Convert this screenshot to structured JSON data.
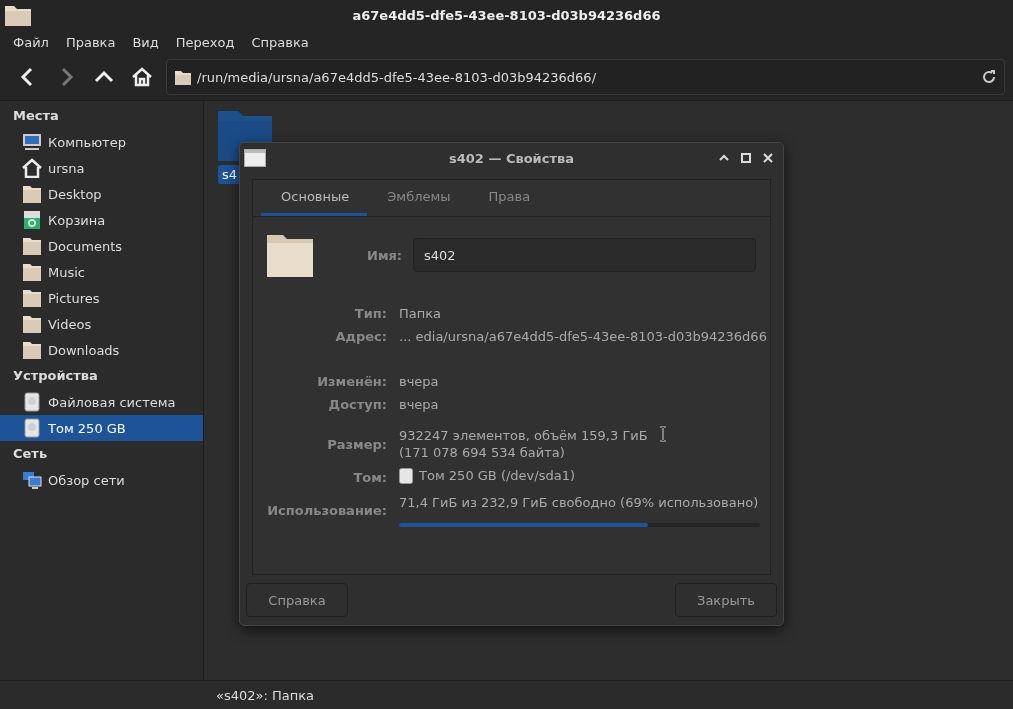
{
  "window": {
    "title": "a67e4dd5-dfe5-43ee-8103-d03b94236d66"
  },
  "menu": [
    "Файл",
    "Правка",
    "Вид",
    "Переход",
    "Справка"
  ],
  "toolbar": [
    {
      "kind": "back",
      "disabled": false
    },
    {
      "kind": "forward",
      "disabled": true
    },
    {
      "kind": "up",
      "disabled": false
    },
    {
      "kind": "home",
      "disabled": false
    }
  ],
  "location": "/run/media/ursna/a67e4dd5-dfe5-43ee-8103-d03b94236d66/",
  "sidebar": [
    {
      "heading": "Места",
      "items": [
        {
          "label": "Компьютер",
          "kind": "computer",
          "selected": false
        },
        {
          "label": "ursna",
          "kind": "home",
          "selected": false
        },
        {
          "label": "Desktop",
          "kind": "folder",
          "selected": false
        },
        {
          "label": "Корзина",
          "kind": "trash",
          "selected": false
        },
        {
          "label": "Documents",
          "kind": "folder",
          "selected": false
        },
        {
          "label": "Music",
          "kind": "folder",
          "selected": false
        },
        {
          "label": "Pictures",
          "kind": "folder",
          "selected": false
        },
        {
          "label": "Videos",
          "kind": "folder",
          "selected": false
        },
        {
          "label": "Downloads",
          "kind": "folder",
          "selected": false
        }
      ]
    },
    {
      "heading": "Устройства",
      "items": [
        {
          "label": "Файловая система",
          "kind": "drive",
          "selected": false
        },
        {
          "label": "Том 250 GB",
          "kind": "drive",
          "selected": true
        }
      ]
    },
    {
      "heading": "Сеть",
      "items": [
        {
          "label": "Обзор сети",
          "kind": "network",
          "selected": false
        }
      ]
    }
  ],
  "files": [
    {
      "name": "s4",
      "selected": true
    }
  ],
  "status_bar": "«s402»: Папка",
  "dialog": {
    "title": "s402 — Свойства",
    "tabs": [
      {
        "label": "Основные",
        "selected": true
      },
      {
        "label": "Эмблемы",
        "selected": false
      },
      {
        "label": "Права",
        "selected": false
      }
    ],
    "name_label": "Имя:",
    "name_value": "s402",
    "groups": [
      [
        {
          "kind": "text",
          "label": "Тип:",
          "value": "Папка"
        },
        {
          "kind": "text",
          "label": "Адрес:",
          "value": "... edia/ursna/a67e4dd5-dfe5-43ee-8103-d03b94236d66"
        }
      ],
      [
        {
          "kind": "text",
          "label": "Изменён:",
          "value": "вчера"
        },
        {
          "kind": "text",
          "label": "Доступ:",
          "value": "вчера"
        }
      ],
      [
        {
          "kind": "multiline",
          "label": "Размер:",
          "value": "932247 элементов, объём 159,3 ГиБ",
          "value2": "(171 078 694 534 байта)"
        },
        {
          "kind": "volume",
          "label": "Том:",
          "value": "Том 250 GB (/dev/sda1)"
        },
        {
          "kind": "usage",
          "label": "Использование:",
          "value": "71,4 ГиБ из 232,9 ГиБ свободно (69% использовано)",
          "level": 0.69
        }
      ]
    ],
    "buttons": [
      "Справка",
      "Закрыть"
    ]
  }
}
